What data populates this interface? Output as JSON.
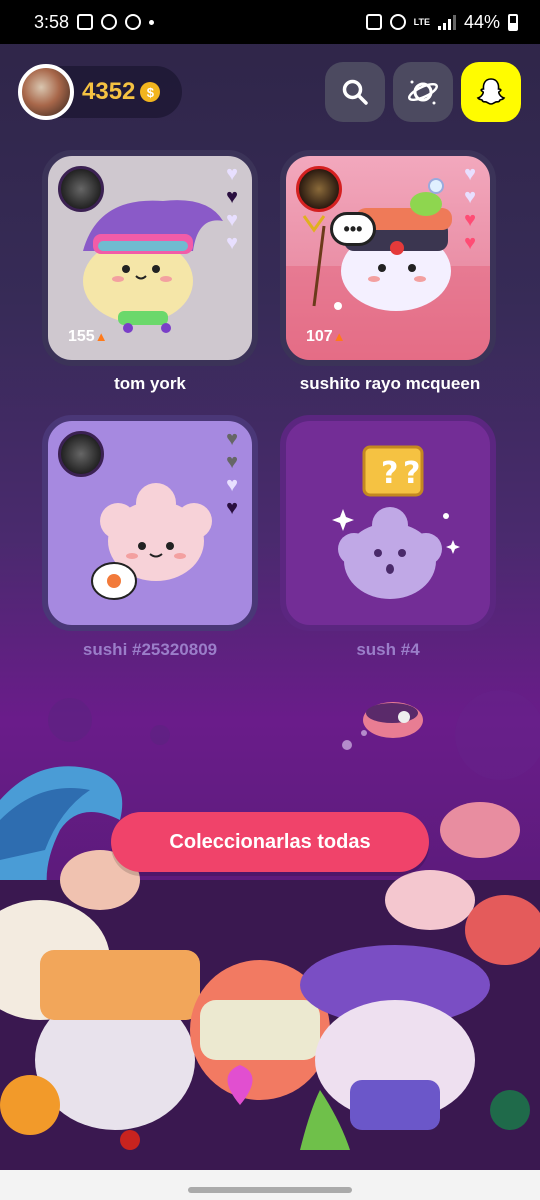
{
  "status_bar": {
    "time": "3:58",
    "network": "LTE",
    "battery": "44%"
  },
  "header": {
    "coin_count": "4352",
    "coin_icon": "coin-icon",
    "buttons": [
      "search-icon",
      "planet-icon",
      "snapchat-ghost-icon"
    ]
  },
  "cards": [
    {
      "name": "tom york",
      "streak": "155"
    },
    {
      "name": "sushito rayo mcqueen",
      "streak": "107",
      "bubble": "•••"
    },
    {
      "name": "sushi #25320809"
    },
    {
      "name": "sush #4"
    }
  ],
  "cta": {
    "label": "Coleccionarlas todas"
  },
  "colors": {
    "accent": "#f0436a",
    "snap_yellow": "#fffc00",
    "coin": "#f5c242"
  }
}
